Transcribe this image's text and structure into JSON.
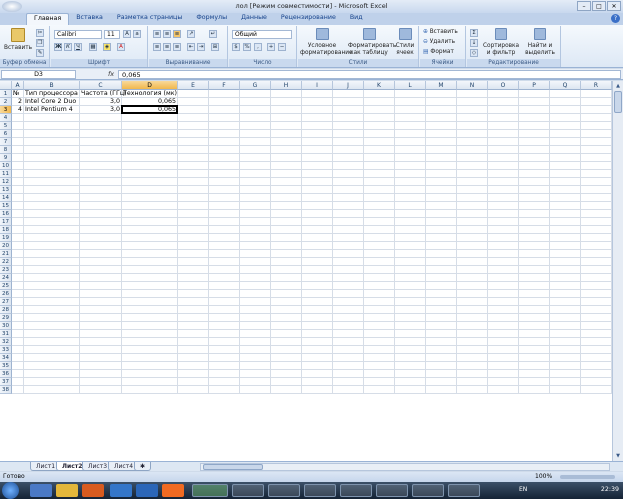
{
  "window": {
    "title": "лол [Режим совместимости] - Microsoft Excel",
    "buttons": [
      "–",
      "□",
      "✕"
    ]
  },
  "ribbon_tabs": [
    "Главная",
    "Вставка",
    "Разметка страницы",
    "Формулы",
    "Данные",
    "Рецензирование",
    "Вид"
  ],
  "ribbon": {
    "clipboard": {
      "label": "Буфер обмена",
      "paste": "Вставить"
    },
    "font": {
      "label": "Шрифт",
      "name": "Calibri",
      "size": "11"
    },
    "alignment": {
      "label": "Выравнивание"
    },
    "number": {
      "label": "Число",
      "format": "Общий"
    },
    "styles": {
      "label": "Стили",
      "cond": "Условное форматирование",
      "table": "Форматировать как таблицу",
      "cell": "Стили ячеек"
    },
    "cells": {
      "label": "Ячейки",
      "insert": "Вставить",
      "delete": "Удалить",
      "format": "Формат"
    },
    "editing": {
      "label": "Редактирование",
      "sort": "Сортировка и фильтр",
      "find": "Найти и выделить"
    }
  },
  "formula_bar": {
    "name_box": "D3",
    "fx": "fx",
    "value": "0,065"
  },
  "grid": {
    "columns": [
      "A",
      "B",
      "C",
      "D",
      "E",
      "F",
      "G",
      "H",
      "I",
      "J",
      "K",
      "L",
      "M",
      "N",
      "O",
      "P",
      "Q",
      "R"
    ],
    "selected_column": "D",
    "selected_row": "3",
    "rows": [
      "1",
      "2",
      "3",
      "4",
      "5",
      "6",
      "7",
      "8",
      "9",
      "10",
      "11",
      "12",
      "13",
      "14",
      "15",
      "16",
      "17",
      "18",
      "19",
      "20",
      "21",
      "22",
      "23",
      "24",
      "25",
      "26",
      "27",
      "28",
      "29",
      "30",
      "31",
      "32",
      "33",
      "34",
      "35",
      "36",
      "37",
      "38"
    ],
    "cells": {
      "A1": "№",
      "B1": "Тип процессора",
      "C1": "Частота (ГГц)",
      "D1": "Технология (мк)",
      "A2": "2",
      "B2": "Intel Core 2 Duo",
      "C2": "3,0",
      "D2": "0,065",
      "A3": "4",
      "B3": "Intel Pentium 4",
      "C3": "3,0",
      "D3": "0,065"
    }
  },
  "sheets": [
    "Лист1",
    "Лист2",
    "Лист3",
    "Лист4"
  ],
  "active_sheet": "Лист2",
  "status": {
    "ready": "Готово",
    "zoom": "100%"
  },
  "taskbar": {
    "lang": "EN",
    "time": "22:39"
  }
}
